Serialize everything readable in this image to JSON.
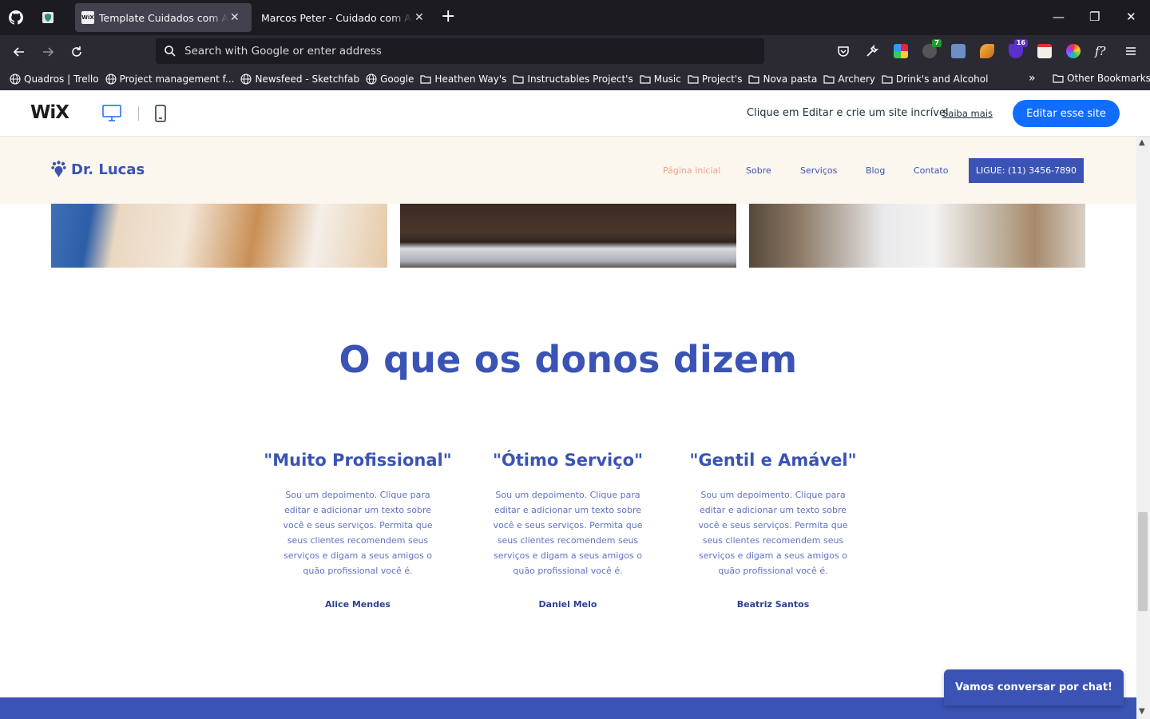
{
  "browser": {
    "tabs": [
      {
        "title": "Template Cuidados com Anima",
        "active": true,
        "favicon": "WiX"
      },
      {
        "title": "Marcos Peter - Cuidado com Anima",
        "active": false
      }
    ],
    "window_controls": {
      "minimize": "—",
      "restore": "❐",
      "close": "✕"
    },
    "address_placeholder": "Search with Google or enter address",
    "extensions": {
      "badge1": "7",
      "badge2": "16"
    },
    "bookmarks": [
      {
        "label": "Quadros | Trello",
        "icon": "globe-icon"
      },
      {
        "label": "Project management f...",
        "icon": "globe-icon"
      },
      {
        "label": "Newsfeed - Sketchfab",
        "icon": "globe-icon"
      },
      {
        "label": "Google",
        "icon": "globe-icon"
      },
      {
        "label": "Heathen Way's",
        "icon": "folder-icon"
      },
      {
        "label": "Instructables Project's",
        "icon": "folder-icon"
      },
      {
        "label": "Music",
        "icon": "folder-icon"
      },
      {
        "label": "Project's",
        "icon": "folder-icon"
      },
      {
        "label": "Nova pasta",
        "icon": "folder-icon"
      },
      {
        "label": "Archery",
        "icon": "folder-icon"
      },
      {
        "label": "Drink's and Alcohol",
        "icon": "folder-icon"
      }
    ],
    "other_bookmarks": "Other Bookmarks"
  },
  "wix": {
    "logo": "WiX",
    "cta_text": "Clique em Editar e crie um site incrível",
    "learn_more": "Saiba mais",
    "edit_button": "Editar esse site"
  },
  "site": {
    "brand": "Dr. Lucas",
    "menu": [
      "Página Inicial",
      "Sobre",
      "Serviços",
      "Blog",
      "Contato"
    ],
    "call_button": "LIGUE: (11) 3456-7890",
    "section_title": "O que os donos dizem",
    "testimonials": [
      {
        "quote": "\"Muito Profissional\"",
        "body": "Sou um depoimento. Clique para editar e adicionar um texto sobre você e seus serviços. Permita que seus clientes recomendem seus serviços e digam a seus amigos o quão profissional você é.",
        "name": "Alice Mendes"
      },
      {
        "quote": "\"Ótimo Serviço\"",
        "body": "Sou um depoimento. Clique para editar e adicionar um texto sobre você e seus serviços. Permita que seus clientes recomendem seus serviços e digam a seus amigos o quão profissional você é.",
        "name": "Daniel Melo"
      },
      {
        "quote": "\"Gentil e Amável\"",
        "body": "Sou um depoimento. Clique para editar e adicionar um texto sobre você e seus serviços. Permita que seus clientes recomendem seus serviços e digam a seus amigos o quão profissional você é.",
        "name": "Beatriz Santos"
      }
    ],
    "chat_button": "Vamos conversar por chat!"
  },
  "colors": {
    "brand_blue": "#3a53b4",
    "wix_blue": "#116dff",
    "menu_active": "#f1a08a",
    "header_bg": "#fbf6ee"
  }
}
